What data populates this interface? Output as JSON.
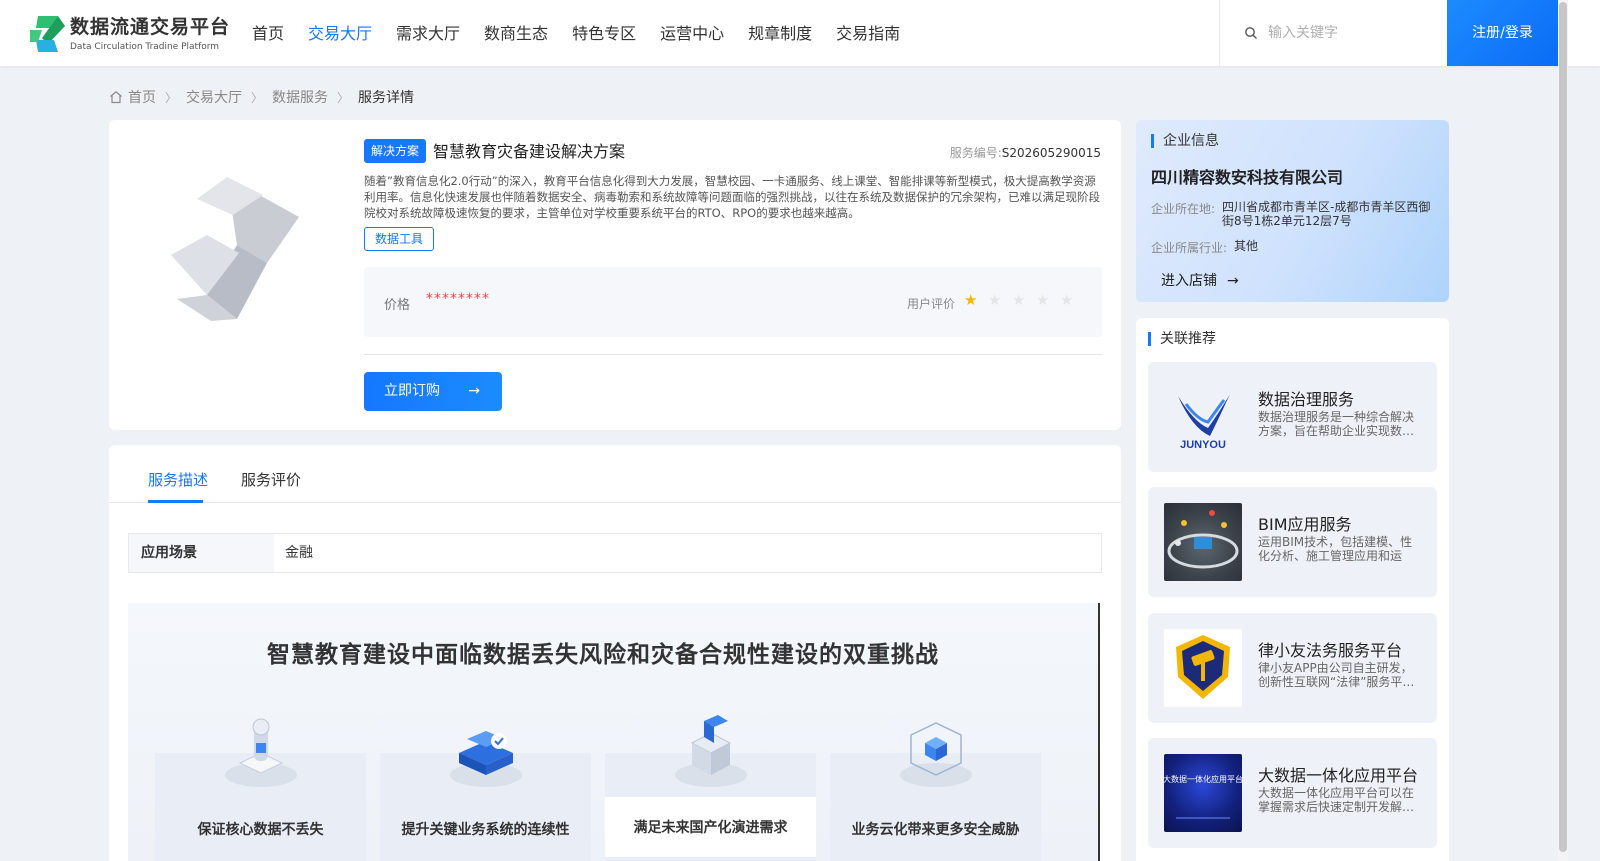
{
  "header": {
    "logo_title": "数据流通交易平台",
    "logo_subtitle": "Data Circulation Tradine Platform",
    "nav": [
      "首页",
      "交易大厅",
      "需求大厅",
      "数商生态",
      "特色专区",
      "运营中心",
      "规章制度",
      "交易指南"
    ],
    "active_nav": "交易大厅",
    "search_placeholder": "输入关键字",
    "login_label": "注册/登录"
  },
  "breadcrumb": [
    "首页",
    "交易大厅",
    "数据服务",
    "服务详情"
  ],
  "product": {
    "tag": "解决方案",
    "title": "智慧教育灾备建设解决方案",
    "service_no_label": "服务编号:",
    "service_no": "S202605290015",
    "description": "随着”教育信息化2.0行动”的深入，教育平台信息化得到大力发展，智慧校园、一卡通服务、线上课堂、智能排课等新型模式，极大提高教学资源利用率。信息化快速发展也伴随着数据安全、病毒勒索和系统故障等问题面临的强烈挑战，以往在系统及数据保护的冗余架构，已难以满足现阶段院校对系统故障极速恢复的要求，主管单位对学校重要系统平台的RTO、RPO的要求也越来越高。",
    "category_tag": "数据工具",
    "price_label": "价格",
    "price_value": "********",
    "rating_label": "用户评价",
    "rating": 1,
    "rating_max": 5,
    "buy_label": "立即订购"
  },
  "detail": {
    "tabs": [
      "服务描述",
      "服务评价"
    ],
    "active_tab": "服务描述",
    "scene_key": "应用场景",
    "scene_value": "金融",
    "banner_title": "智慧教育建设中面临数据丢失风险和灾备合规性建设的双重挑战",
    "features": [
      "保证核心数据不丢失",
      "提升关键业务系统的连续性",
      "满足未来国产化演进需求",
      "业务云化带来更多安全威胁"
    ]
  },
  "company": {
    "section_title": "企业信息",
    "name": "四川精容数安科技有限公司",
    "location_label": "企业所在地:",
    "location": "四川省成都市青羊区-成都市青羊区西御街8号1栋2单元12层7号",
    "industry_label": "企业所属行业:",
    "industry": "其他",
    "enter_label": "进入店铺"
  },
  "related": {
    "section_title": "关联推荐",
    "items": [
      {
        "title": "数据治理服务",
        "desc": "数据治理服务是一种综合解决方案，旨在帮助企业实现数…",
        "logo_text": "JUNYOU"
      },
      {
        "title": "BIM应用服务",
        "desc": "运用BIM技术，包括建模、性化分析、施工管理应用和运维…"
      },
      {
        "title": "律小友法务服务平台",
        "desc": "律小友APP由公司自主研发，创新性互联网“法律”服务平…"
      },
      {
        "title": "大数据一体化应用平台",
        "desc": "大数据一体化应用平台可以在掌握需求后快速定制开发解…",
        "logo_text": "大数据一体化应用平台"
      }
    ]
  },
  "colors": {
    "accent": "#1677ff",
    "price": "#f04747",
    "star": "#f7b500",
    "background": "#eef1f6"
  }
}
